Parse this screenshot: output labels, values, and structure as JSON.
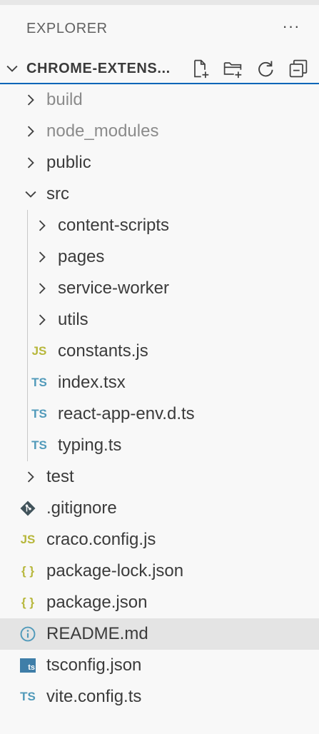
{
  "explorer": {
    "title": "EXPLORER",
    "more_label": "···",
    "section_title": "CHROME-EXTENS...",
    "actions": [
      "new-file-icon",
      "new-folder-icon",
      "refresh-icon",
      "collapse-all-icon"
    ]
  },
  "tree": [
    {
      "label": "build",
      "kind": "folder",
      "depth": 1,
      "expanded": false,
      "dim": true
    },
    {
      "label": "node_modules",
      "kind": "folder",
      "depth": 1,
      "expanded": false,
      "dim": true
    },
    {
      "label": "public",
      "kind": "folder",
      "depth": 1,
      "expanded": false
    },
    {
      "label": "src",
      "kind": "folder",
      "depth": 1,
      "expanded": true
    },
    {
      "label": "content-scripts",
      "kind": "folder",
      "depth": 2,
      "expanded": false
    },
    {
      "label": "pages",
      "kind": "folder",
      "depth": 2,
      "expanded": false
    },
    {
      "label": "service-worker",
      "kind": "folder",
      "depth": 2,
      "expanded": false
    },
    {
      "label": "utils",
      "kind": "folder",
      "depth": 2,
      "expanded": false
    },
    {
      "label": "constants.js",
      "kind": "js",
      "depth": 2,
      "icon_text": "JS"
    },
    {
      "label": "index.tsx",
      "kind": "ts",
      "depth": 2,
      "icon_text": "TS"
    },
    {
      "label": "react-app-env.d.ts",
      "kind": "ts",
      "depth": 2,
      "icon_text": "TS"
    },
    {
      "label": "typing.ts",
      "kind": "ts",
      "depth": 2,
      "icon_text": "TS"
    },
    {
      "label": "test",
      "kind": "folder",
      "depth": 1,
      "expanded": false
    },
    {
      "label": ".gitignore",
      "kind": "git",
      "depth": 1
    },
    {
      "label": "craco.config.js",
      "kind": "js",
      "depth": 1,
      "icon_text": "JS"
    },
    {
      "label": "package-lock.json",
      "kind": "json",
      "depth": 1,
      "icon_text": "{ }"
    },
    {
      "label": "package.json",
      "kind": "json",
      "depth": 1,
      "icon_text": "{ }"
    },
    {
      "label": "README.md",
      "kind": "info",
      "depth": 1,
      "selected": true
    },
    {
      "label": "tsconfig.json",
      "kind": "tsconfig",
      "depth": 1,
      "icon_text": "ts"
    },
    {
      "label": "vite.config.ts",
      "kind": "ts",
      "depth": 1,
      "icon_text": "TS"
    }
  ],
  "colors": {
    "accent": "#0066b8",
    "js": "#b7b73b",
    "ts": "#519aba",
    "dim": "#8b8b8b",
    "selected": "#e4e4e4"
  }
}
